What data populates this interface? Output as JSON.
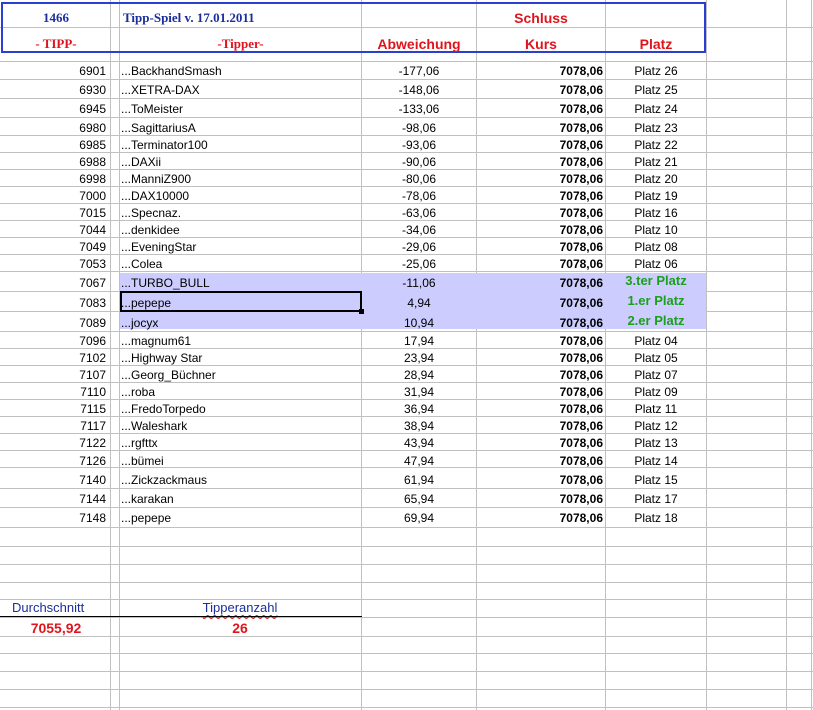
{
  "header": {
    "count": "1466",
    "title": "Tipp-Spiel v. 17.01.2011",
    "schluss": "Schluss",
    "col_tipp": "- TIPP-",
    "col_tipper": "-Tipper-",
    "col_abweichung": "Abweichung",
    "col_kurs": "Kurs",
    "col_platz": "Platz"
  },
  "rows": [
    {
      "tipp": "6901",
      "tipper": "...BackhandSmash",
      "abw": "-177,06",
      "kurs": "7078,06",
      "platz": "Platz 26"
    },
    {
      "tipp": "6930",
      "tipper": "...XETRA-DAX",
      "abw": "-148,06",
      "kurs": "7078,06",
      "platz": "Platz 25"
    },
    {
      "tipp": "6945",
      "tipper": "...ToMeister",
      "abw": "-133,06",
      "kurs": "7078,06",
      "platz": "Platz 24"
    },
    {
      "tipp": "6980",
      "tipper": "...SagittariusA",
      "abw": "-98,06",
      "kurs": "7078,06",
      "platz": "Platz 23"
    },
    {
      "tipp": "6985",
      "tipper": "...Terminator100",
      "abw": "-93,06",
      "kurs": "7078,06",
      "platz": "Platz 22"
    },
    {
      "tipp": "6988",
      "tipper": "...DAXii",
      "abw": "-90,06",
      "kurs": "7078,06",
      "platz": "Platz 21"
    },
    {
      "tipp": "6998",
      "tipper": "...ManniZ900",
      "abw": "-80,06",
      "kurs": "7078,06",
      "platz": "Platz 20"
    },
    {
      "tipp": "7000",
      "tipper": "...DAX10000",
      "abw": "-78,06",
      "kurs": "7078,06",
      "platz": "Platz 19"
    },
    {
      "tipp": "7015",
      "tipper": "...Specnaz.",
      "abw": "-63,06",
      "kurs": "7078,06",
      "platz": "Platz 16"
    },
    {
      "tipp": "7044",
      "tipper": "...denkidee",
      "abw": "-34,06",
      "kurs": "7078,06",
      "platz": "Platz 10"
    },
    {
      "tipp": "7049",
      "tipper": "...EveningStar",
      "abw": "-29,06",
      "kurs": "7078,06",
      "platz": "Platz 08"
    },
    {
      "tipp": "7053",
      "tipper": "...Colea",
      "abw": "-25,06",
      "kurs": "7078,06",
      "platz": "Platz 06"
    },
    {
      "tipp": "7067",
      "tipper": "...TURBO_BULL",
      "abw": "-11,06",
      "kurs": "7078,06",
      "platz": "3.ter Platz"
    },
    {
      "tipp": "7083",
      "tipper": "...pepepe",
      "abw": "4,94",
      "kurs": "7078,06",
      "platz": "1.er Platz"
    },
    {
      "tipp": "7089",
      "tipper": "...jocyx",
      "abw": "10,94",
      "kurs": "7078,06",
      "platz": "2.er Platz"
    },
    {
      "tipp": "7096",
      "tipper": "...magnum61",
      "abw": "17,94",
      "kurs": "7078,06",
      "platz": "Platz 04"
    },
    {
      "tipp": "7102",
      "tipper": "...Highway Star",
      "abw": "23,94",
      "kurs": "7078,06",
      "platz": "Platz 05"
    },
    {
      "tipp": "7107",
      "tipper": "...Georg_Büchner",
      "abw": "28,94",
      "kurs": "7078,06",
      "platz": "Platz 07"
    },
    {
      "tipp": "7110",
      "tipper": "...roba",
      "abw": "31,94",
      "kurs": "7078,06",
      "platz": "Platz 09"
    },
    {
      "tipp": "7115",
      "tipper": "...FredoTorpedo",
      "abw": "36,94",
      "kurs": "7078,06",
      "platz": "Platz 11"
    },
    {
      "tipp": "7117",
      "tipper": "...Waleshark",
      "abw": "38,94",
      "kurs": "7078,06",
      "platz": "Platz 12"
    },
    {
      "tipp": "7122",
      "tipper": "...rgfttx",
      "abw": "43,94",
      "kurs": "7078,06",
      "platz": "Platz 13"
    },
    {
      "tipp": "7126",
      "tipper": "...bümei",
      "abw": "47,94",
      "kurs": "7078,06",
      "platz": "Platz 14"
    },
    {
      "tipp": "7140",
      "tipper": "...Zickzackmaus",
      "abw": "61,94",
      "kurs": "7078,06",
      "platz": "Platz 15"
    },
    {
      "tipp": "7144",
      "tipper": "...karakan",
      "abw": "65,94",
      "kurs": "7078,06",
      "platz": "Platz 17"
    },
    {
      "tipp": "7148",
      "tipper": "...pepepe",
      "abw": "69,94",
      "kurs": "7078,06",
      "platz": "Platz 18"
    }
  ],
  "footer": {
    "durchschnitt_label": "Durchschnitt",
    "durchschnitt_value": "7055,92",
    "tipperanzahl_label": "Tipperanzahl",
    "tipperanzahl_value": "26"
  },
  "colors": {
    "header_blue": "#1a2f9c",
    "header_red": "#e0141c",
    "podium_green": "#1aa01a",
    "highlight_band": "#ccccff",
    "grid": "#c0c0c0"
  }
}
